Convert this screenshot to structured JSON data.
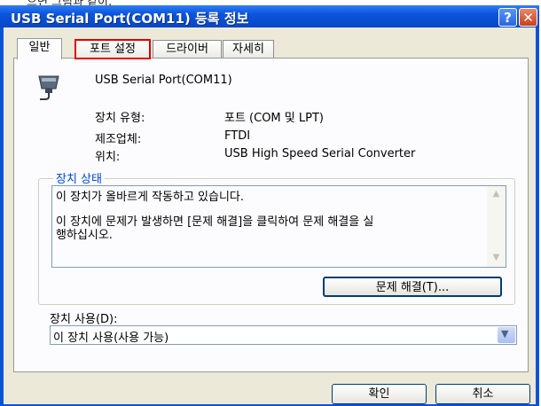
{
  "caption_cropped": "으면 그림과 같이,",
  "window": {
    "title": "USB Serial Port(COM11) 등록 정보"
  },
  "tabs": [
    {
      "label": "일반"
    },
    {
      "label": "포트 설정"
    },
    {
      "label": "드라이버"
    },
    {
      "label": "자세히"
    }
  ],
  "device": {
    "name": "USB Serial Port(COM11)"
  },
  "properties": {
    "type_label": "장치 유형:",
    "type_value": "포트 (COM 및 LPT)",
    "manufacturer_label": "제조업체:",
    "manufacturer_value": "FTDI",
    "location_label": "위치:",
    "location_value": "USB High Speed Serial Converter"
  },
  "status": {
    "group_title": "장치 상태",
    "line1": "이 장치가 올바르게 작동하고 있습니다.",
    "line2": "이 장치에 문제가 발생하면 [문제 해결]을 클릭하여 문제 해결을 실",
    "line3": "행하십시오.",
    "troubleshoot_button": "문제 해결(T)..."
  },
  "usage": {
    "label": "장치 사용(D):",
    "selected": "이 장치 사용(사용 가능)"
  },
  "buttons": {
    "ok": "확인",
    "cancel": "취소"
  },
  "colors": {
    "title_blue": "#0a54dc",
    "highlight_red": "#e00000",
    "client": "#ece9d8"
  }
}
